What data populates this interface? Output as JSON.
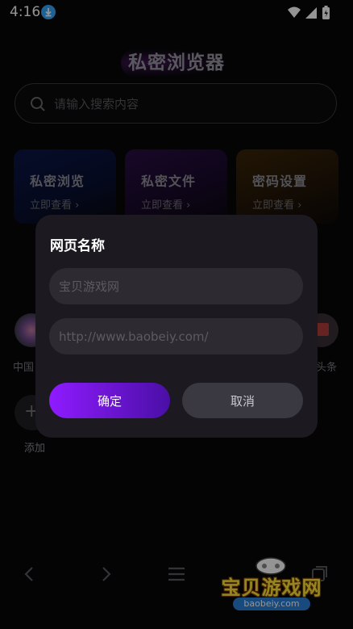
{
  "status_bar": {
    "time": "4:16",
    "icons": [
      "download-badge-icon",
      "wifi-icon",
      "signal-icon",
      "battery-icon"
    ]
  },
  "app": {
    "title": "私密浏览器"
  },
  "search": {
    "placeholder": "请输入搜索内容"
  },
  "cards": [
    {
      "title": "私密浏览",
      "subtitle": "立即查看 ›"
    },
    {
      "title": "私密文件",
      "subtitle": "立即查看 ›"
    },
    {
      "title": "密码设置",
      "subtitle": "立即查看 ›"
    }
  ],
  "shortcuts": {
    "left_label": "中国",
    "right_label": "头条",
    "add_label": "添加",
    "add_symbol": "+"
  },
  "dialog": {
    "title": "网页名称",
    "name_placeholder": "宝贝游戏网",
    "url_placeholder": "http://www.baobeiy.com/",
    "confirm_label": "确定",
    "cancel_label": "取消"
  },
  "watermark": {
    "text": "宝贝游戏网",
    "url": "baobeiy.com"
  },
  "colors": {
    "accent": "#8f1bff",
    "background": "#070709",
    "dialog": "#1c1a20"
  }
}
